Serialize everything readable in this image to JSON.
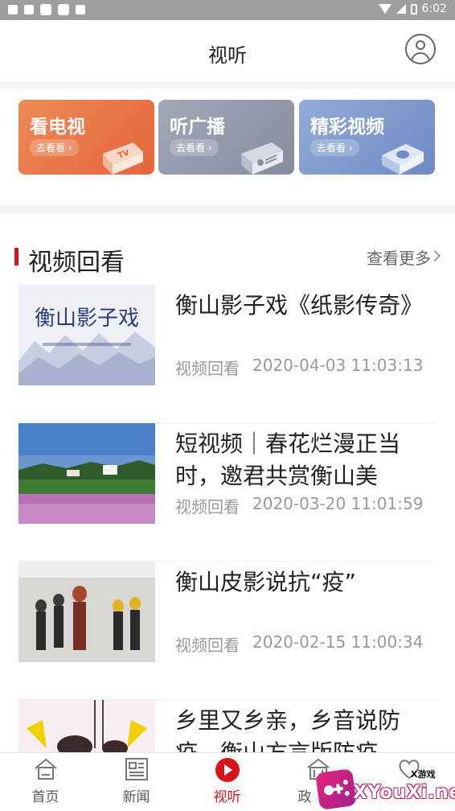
{
  "status_bar": {
    "time": "6:02"
  },
  "header": {
    "title": "视听"
  },
  "cards": [
    {
      "title": "看电视",
      "button": "去看看",
      "color": "#e86d43"
    },
    {
      "title": "听广播",
      "button": "去看看",
      "color": "#9298a9"
    },
    {
      "title": "精彩视频",
      "button": "去看看",
      "color": "#7d97cc"
    }
  ],
  "section": {
    "title": "视频回看",
    "more": "查看更多"
  },
  "items": [
    {
      "title": "衡山影子戏《纸影传奇》",
      "category": "视频回看",
      "time": "2020-04-03 11:03:13"
    },
    {
      "title": "短视频｜春花烂漫正当时，邀君共赏衡山美",
      "category": "视频回看",
      "time": "2020-03-20 11:01:59"
    },
    {
      "title": "衡山皮影说抗“疫”",
      "category": "视频回看",
      "time": "2020-02-15 11:00:34"
    },
    {
      "title": "乡里又乡亲，乡音说防疫，衡山方言版防疫",
      "category": "",
      "time": ""
    }
  ],
  "thumb_text": {
    "item0": "衡山影子戏"
  },
  "tabbar": [
    {
      "label": "首页",
      "icon": "home-icon",
      "active": false
    },
    {
      "label": "新闻",
      "icon": "news-icon",
      "active": false
    },
    {
      "label": "视听",
      "icon": "play-icon",
      "active": true
    },
    {
      "label": "政",
      "icon": "government-icon",
      "active": false
    },
    {
      "label": "",
      "icon": "heart-icon",
      "active": false
    }
  ],
  "watermark": {
    "small": "X游戏",
    "text": "XYouXi.net"
  },
  "colors": {
    "accent": "#d7141a",
    "text": "#222222",
    "meta": "#999999"
  }
}
